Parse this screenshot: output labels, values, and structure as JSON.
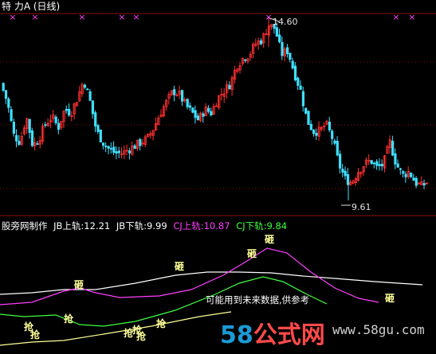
{
  "window": {
    "title": "特  力A (日线)"
  },
  "price_labels": {
    "high": "14.60",
    "low": "9.61"
  },
  "indicator": {
    "author": "股旁网制作",
    "items": [
      {
        "label": "JB上轨:12.21",
        "color": "#ffffff"
      },
      {
        "label": "JB下轨:9.99",
        "color": "#ffffff"
      },
      {
        "label": "CJ上轨:10.87",
        "color": "#ff40ff"
      },
      {
        "label": "CJ下轨:9.84",
        "color": "#40ff40"
      }
    ]
  },
  "signals": {
    "sell": "砸",
    "buy": "抢"
  },
  "note": "可能用到未来数据,供参考",
  "watermark": {
    "num": "58",
    "brand": "公式网",
    "url": "www.58gu.com",
    "num_color": "#1a9ad6",
    "brand_color": "#ff4a4a"
  },
  "colors": {
    "up": "#ff3030",
    "down": "#40e0ff",
    "sell_mark": "#ff40ff",
    "grid": "#8b1010"
  }
}
